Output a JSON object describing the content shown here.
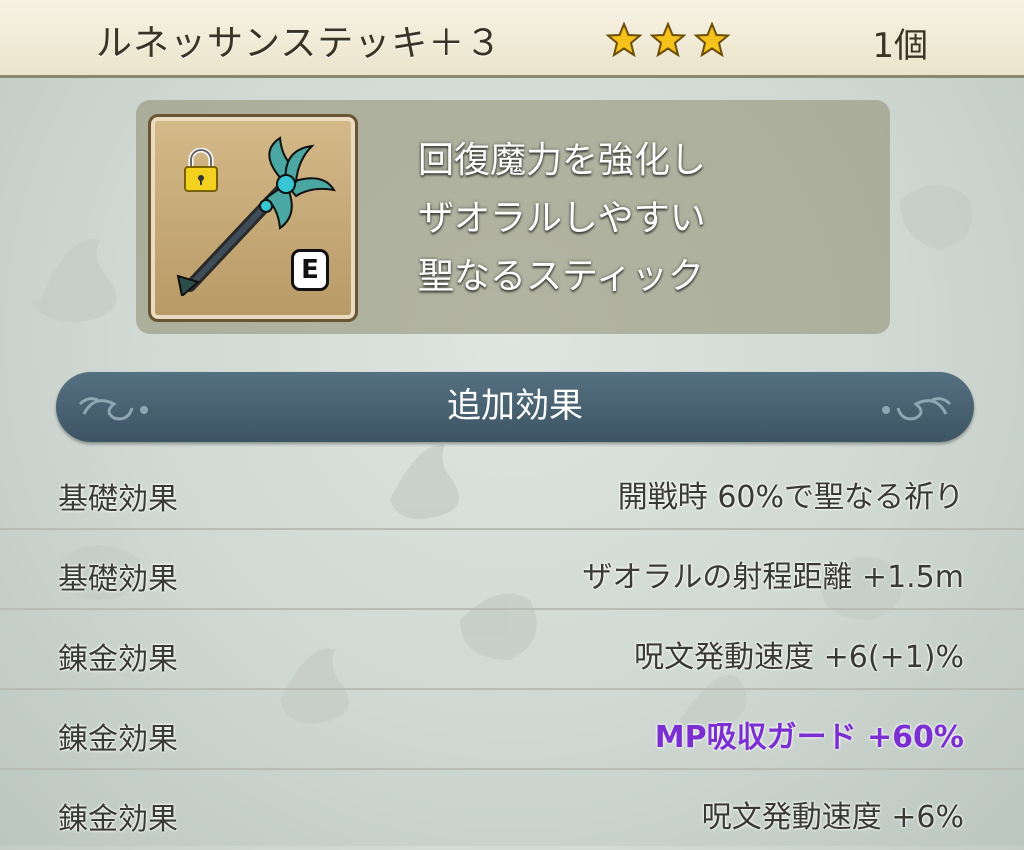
{
  "header": {
    "item_name": "ルネッサンステッキ＋３",
    "rarity_stars": 3,
    "quantity": "1個"
  },
  "item": {
    "icon": "staff-icon",
    "locked": true,
    "grade": "E",
    "description": [
      "回復魔力を強化し",
      "ザオラルしやすい",
      "聖なるスティック"
    ]
  },
  "section": {
    "title": "追加効果"
  },
  "effects": [
    {
      "label": "基礎効果",
      "value": "開戦時  60%で聖なる祈り"
    },
    {
      "label": "基礎効果",
      "value": "ザオラルの射程距離  +1.5m"
    },
    {
      "label": "錬金効果",
      "value": "呪文発動速度  +6(+1)%"
    },
    {
      "label": "錬金効果",
      "value": "MP吸収ガード  +60%"
    },
    {
      "label": "錬金効果",
      "value": "呪文発動速度  +6%"
    }
  ],
  "colors": {
    "special_effect": "#7b2ed1",
    "banner": "#46606f",
    "star": "#f5c21b"
  }
}
